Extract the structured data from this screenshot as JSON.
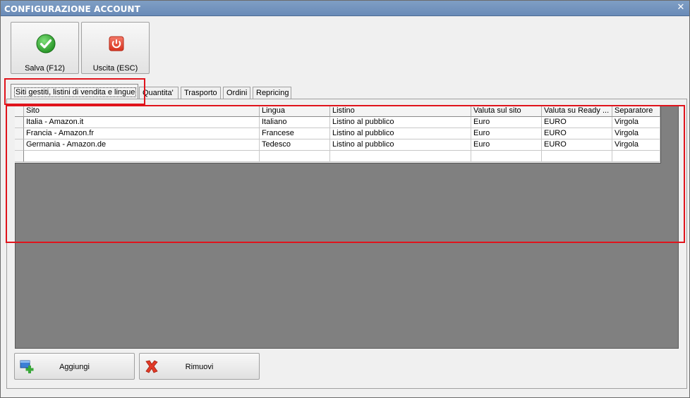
{
  "window": {
    "title": "CONFIGURAZIONE ACCOUNT",
    "close_glyph": "✕"
  },
  "toolbar": {
    "save_label": "Salva (F12)",
    "exit_label": "Uscita (ESC)"
  },
  "tabs": [
    {
      "label": "Siti gestiti, listini di vendita e lingue"
    },
    {
      "label": "Quantita'"
    },
    {
      "label": "Trasporto"
    },
    {
      "label": "Ordini"
    },
    {
      "label": "Repricing"
    }
  ],
  "grid": {
    "columns": [
      "Sito",
      "Lingua",
      "Listino",
      "Valuta sul sito",
      "Valuta su Ready ...",
      "Separatore"
    ],
    "rows": [
      [
        "Italia - Amazon.it",
        "Italiano",
        "Listino al pubblico",
        "Euro",
        "EURO",
        "Virgola"
      ],
      [
        "Francia - Amazon.fr",
        "Francese",
        "Listino al pubblico",
        "Euro",
        "EURO",
        "Virgola"
      ],
      [
        "Germania - Amazon.de",
        "Tedesco",
        "Listino al pubblico",
        "Euro",
        "EURO",
        "Virgola"
      ]
    ]
  },
  "actions": {
    "add_label": "Aggiungi",
    "remove_label": "Rimuovi"
  },
  "icons": {
    "save": "check-circle-icon",
    "exit": "power-icon",
    "add": "add-row-icon",
    "remove": "red-x-icon"
  },
  "colors": {
    "highlight": "#e0141c",
    "titlebar": "#6a8bb8",
    "grid_background": "#808080"
  }
}
